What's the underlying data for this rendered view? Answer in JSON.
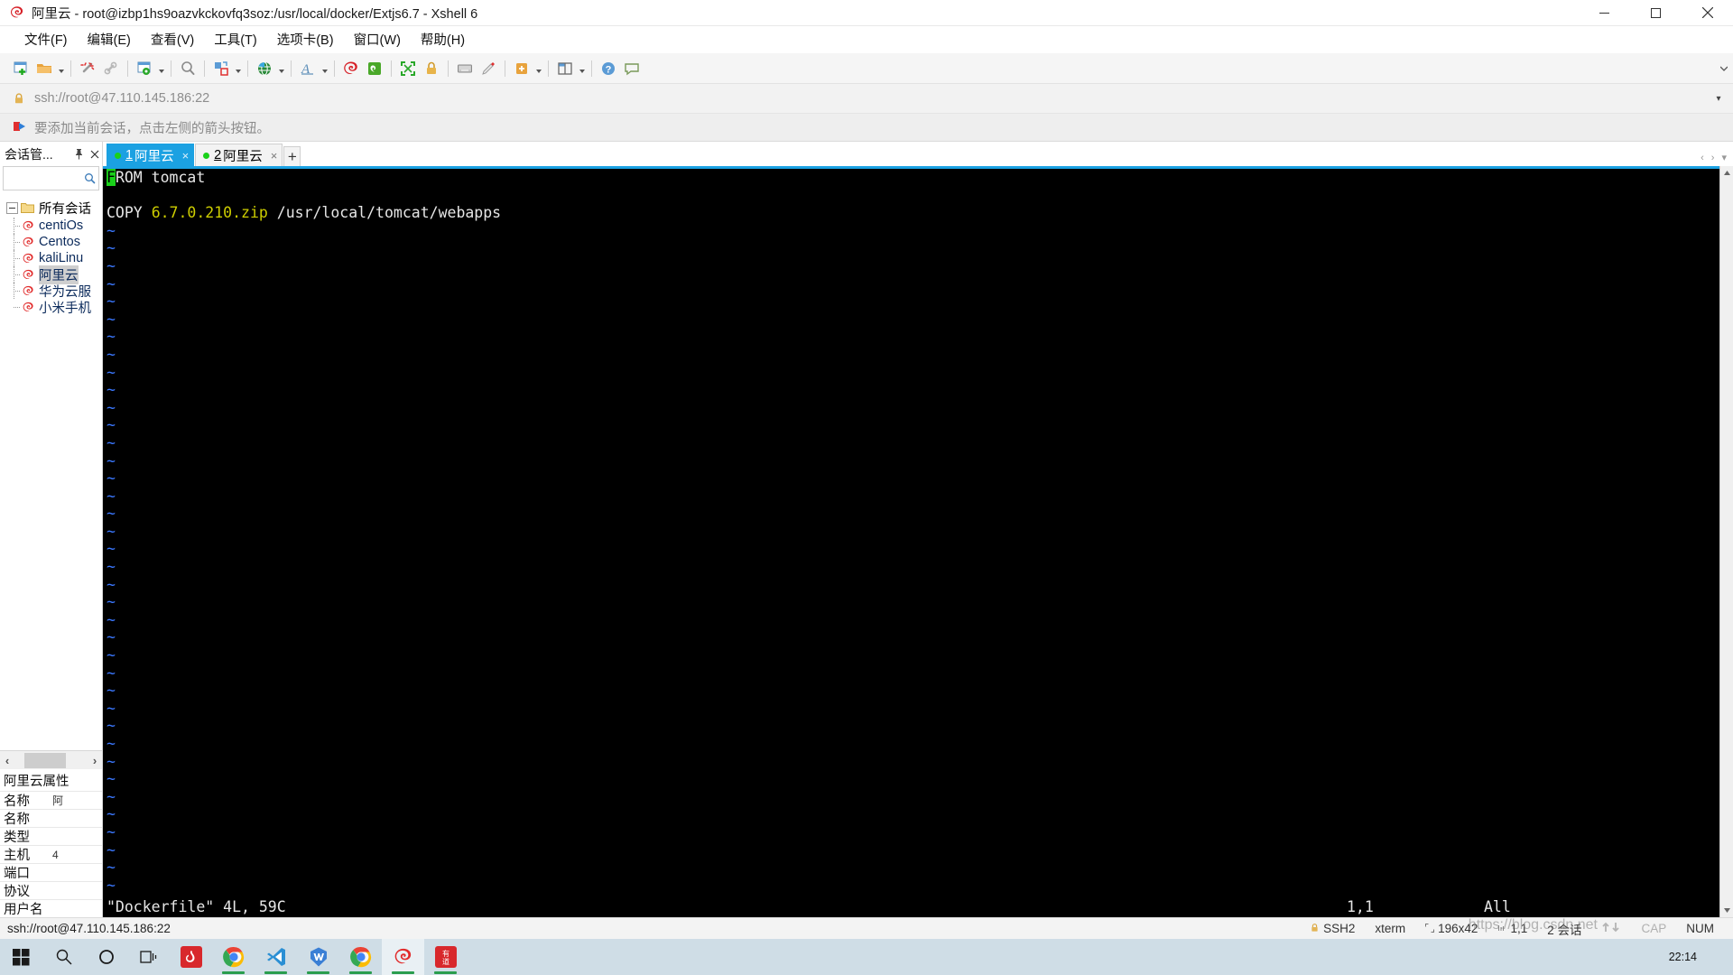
{
  "window": {
    "title": "阿里云 - root@izbp1hs9oazvkckovfq3soz:/usr/local/docker/Extjs6.7 - Xshell 6",
    "app_icon": "xshell-icon",
    "minimize": "minimize-button",
    "maximize": "maximize-button",
    "close": "close-button"
  },
  "menubar": {
    "items": [
      {
        "label": "文件(F)"
      },
      {
        "label": "编辑(E)"
      },
      {
        "label": "查看(V)"
      },
      {
        "label": "工具(T)"
      },
      {
        "label": "选项卡(B)"
      },
      {
        "label": "窗口(W)"
      },
      {
        "label": "帮助(H)"
      }
    ]
  },
  "toolbar": {
    "icons": [
      "new-session-icon",
      "open-folder-icon",
      "disconnect-icon",
      "link-icon",
      "session-properties-icon",
      "find-icon",
      "transfer-icon",
      "web-icon",
      "font-icon",
      "xshell-icon",
      "xftp-icon",
      "fullscreen-icon",
      "lock-icon",
      "keyboard-icon",
      "compose-icon",
      "add-tab-icon",
      "layout-icon",
      "help-icon",
      "feedback-icon"
    ]
  },
  "address": {
    "icon": "lock-icon",
    "value": "ssh://root@47.110.145.186:22",
    "dropdown": "chevron-down-icon"
  },
  "hint": {
    "icon": "arrow-flag-icon",
    "text": "要添加当前会话，点击左侧的箭头按钮。"
  },
  "session_panel": {
    "title": "会话管...",
    "pin": "pin-icon",
    "close": "close-icon",
    "search_placeholder": "",
    "search_value": "",
    "search_icon": "search-icon",
    "root": {
      "label": "所有会话",
      "icon": "folder-icon"
    },
    "items": [
      {
        "label": "centiOs",
        "icon": "xshell-session-icon",
        "selected": false
      },
      {
        "label": "Centos",
        "icon": "xshell-session-icon",
        "selected": false
      },
      {
        "label": "kaliLinu",
        "icon": "xshell-session-icon",
        "selected": false
      },
      {
        "label": "阿里云",
        "icon": "xshell-session-icon",
        "selected": true
      },
      {
        "label": "华为云服",
        "icon": "xshell-session-icon",
        "selected": false
      },
      {
        "label": "小米手机",
        "icon": "xshell-session-icon",
        "selected": false
      }
    ],
    "scroll_left": "‹",
    "scroll_right": "›",
    "properties_title": "阿里云属性",
    "properties": [
      {
        "key": "名称",
        "value": "阿"
      },
      {
        "key": "名称",
        "value": ""
      },
      {
        "key": "类型",
        "value": ""
      },
      {
        "key": "主机",
        "value": "4"
      },
      {
        "key": "端口",
        "value": ""
      },
      {
        "key": "协议",
        "value": ""
      },
      {
        "key": "用户名",
        "value": ""
      }
    ]
  },
  "tabs": {
    "items": [
      {
        "num": "1",
        "label": "阿里云",
        "active": true,
        "dot_color": "#1ad11a",
        "close": "×"
      },
      {
        "num": "2",
        "label": "阿里云",
        "active": false,
        "dot_color": "#1ad11a",
        "close": "×"
      }
    ],
    "add_label": "+",
    "nav_left": "‹",
    "nav_right": "›",
    "nav_menu": "▾"
  },
  "terminal": {
    "lines": [
      {
        "segments": [
          {
            "text": "F",
            "cls": "cursor"
          },
          {
            "text": "ROM tomcat",
            "cls": "c-white"
          }
        ]
      },
      {
        "segments": [
          {
            "text": "",
            "cls": "c-white"
          }
        ]
      },
      {
        "segments": [
          {
            "text": "COPY",
            "cls": "c-white"
          },
          {
            "text": " ",
            "cls": "c-white"
          },
          {
            "text": "6.7.0.210.zip",
            "cls": "c-yellow"
          },
          {
            "text": " /usr/local/tomcat/webapps",
            "cls": "c-white"
          }
        ]
      }
    ],
    "tilde_count": 38,
    "tilde": "~",
    "status": {
      "file": "\"Dockerfile\" 4L, 59C",
      "position": "1,1",
      "scroll": "All"
    }
  },
  "statusbar": {
    "left": "ssh://root@47.110.145.186:22",
    "items": [
      {
        "icon": "lock-icon",
        "label": "SSH2"
      },
      {
        "icon": "",
        "label": "xterm"
      },
      {
        "icon": "size-icon",
        "label": "196x42"
      },
      {
        "icon": "caret-icon",
        "label": "1,1"
      },
      {
        "icon": "",
        "label": "2 会话"
      },
      {
        "icon": "up-down-icon",
        "label": ""
      },
      {
        "icon": "",
        "label": "CAP",
        "dim": true
      },
      {
        "icon": "",
        "label": "NUM",
        "dim": false
      }
    ]
  },
  "taskbar": {
    "items": [
      {
        "name": "start-button",
        "icon": "windows-icon",
        "open": false
      },
      {
        "name": "search-button",
        "icon": "search-icon",
        "open": false
      },
      {
        "name": "cortana-button",
        "icon": "circle-icon",
        "open": false
      },
      {
        "name": "task-view-button",
        "icon": "task-view-icon",
        "open": false
      },
      {
        "name": "netease-music",
        "icon": "netease-icon",
        "open": false
      },
      {
        "name": "chrome",
        "icon": "chrome-icon",
        "open": true
      },
      {
        "name": "vscode",
        "icon": "vscode-icon",
        "open": true
      },
      {
        "name": "wps",
        "icon": "wps-icon",
        "open": true
      },
      {
        "name": "chrome-2",
        "icon": "chrome-icon",
        "open": true
      },
      {
        "name": "xshell",
        "icon": "xshell-icon",
        "open": true,
        "active": true
      },
      {
        "name": "youdao",
        "icon": "youdao-icon",
        "open": true
      }
    ],
    "clock_time": "22:14",
    "watermark": "https://blog.csdn.net"
  },
  "colors": {
    "accent": "#1ba1e2",
    "terminal_bg": "#000000",
    "taskbar_bg": "#cfdde6",
    "toolbar_bg": "#f5f5f5"
  }
}
